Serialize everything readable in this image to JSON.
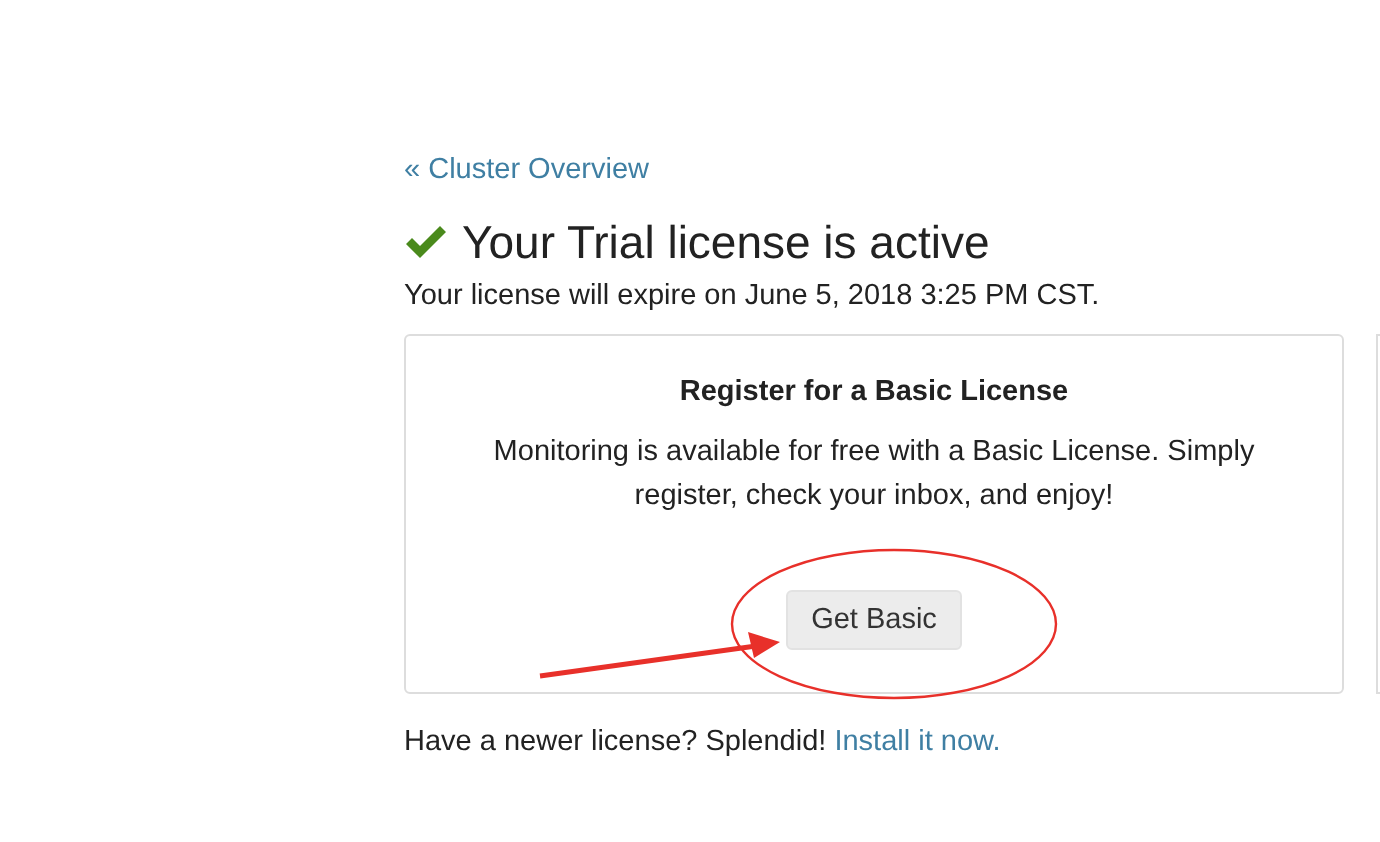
{
  "back_link": "« Cluster Overview",
  "title": "Your Trial license is active",
  "subtitle": "Your license will expire on June 5, 2018 3:25 PM CST.",
  "card": {
    "title": "Register for a Basic License",
    "text": "Monitoring is available for free with a Basic License. Simply register, check your inbox, and enjoy!",
    "button": "Get Basic"
  },
  "footer": {
    "text": "Have a newer license? Splendid!",
    "link": "Install it now."
  }
}
